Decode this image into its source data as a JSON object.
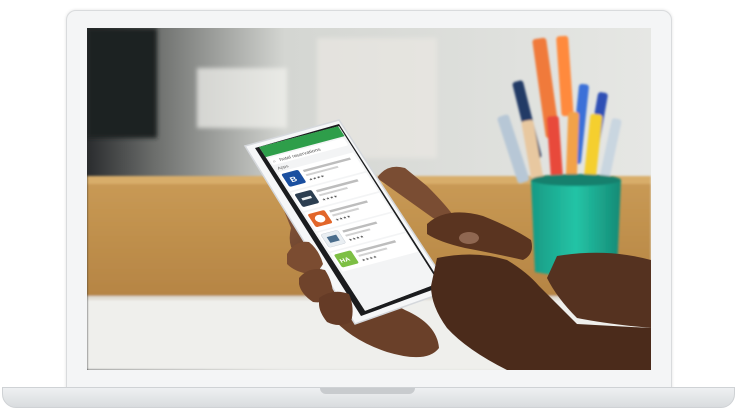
{
  "phone_app": {
    "search_text": "hotel reservations",
    "section_label": "Apps",
    "results": [
      {
        "icon_letter": "B",
        "icon_color": "#1a4fa0",
        "stars": "★★★★"
      },
      {
        "icon_letter": "",
        "icon_color": "#2c3e50",
        "stars": "★★★★"
      },
      {
        "icon_letter": "",
        "icon_color": "#e2662a",
        "stars": "★★★★"
      },
      {
        "icon_letter": "",
        "icon_color": "#e9eef2",
        "stars": "★★★★"
      },
      {
        "icon_letter": "HA",
        "icon_color": "#7dbf44",
        "stars": "★★★★"
      }
    ]
  },
  "colors": {
    "app_bar": "#2e9e4a",
    "cup": "#1fb59a",
    "desk": "#c5924c"
  }
}
